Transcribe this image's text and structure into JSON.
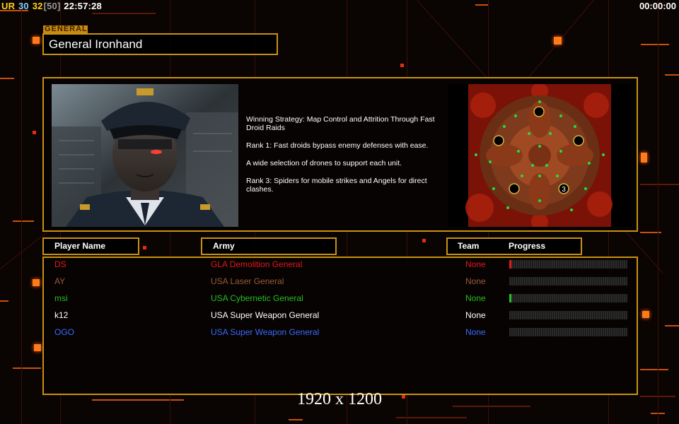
{
  "hud": {
    "stat1": "UR",
    "stat2": "30",
    "stat3": "32",
    "stat4": "[50]",
    "clock": "22:57:28",
    "timer": "00:00:00"
  },
  "general": {
    "tag": "GENERAL",
    "name": "General Ironhand"
  },
  "description": {
    "strategy": "Winning Strategy: Map Control and Attrition Through Fast Droid Raids",
    "rank1": "Rank 1: Fast droids bypass enemy defenses with ease.",
    "drones": "A wide selection of drones to support each unit.",
    "rank3": "Rank 3: Spiders for mobile strikes and Angels for direct clashes."
  },
  "minimap": {
    "start_label": "3"
  },
  "table": {
    "col_player": "Player Name",
    "col_army": "Army",
    "col_team": "Team",
    "col_progress": "Progress"
  },
  "players": [
    {
      "name": "DS",
      "army": "GLA Demolition General",
      "team": "None",
      "color": "#e01a1a",
      "progress": 0.01,
      "fill": "#e01a1a"
    },
    {
      "name": "AY",
      "army": "USA Laser General",
      "team": "None",
      "color": "#9a5a3a",
      "progress": 0.0,
      "fill": "#9a5a3a"
    },
    {
      "name": "msi",
      "army": "USA Cybernetic General",
      "team": "None",
      "color": "#22c022",
      "progress": 0.01,
      "fill": "#22c022"
    },
    {
      "name": "k12",
      "army": "USA Super Weapon General",
      "team": "None",
      "color": "#ffffff",
      "progress": 0.0,
      "fill": "#ffffff"
    },
    {
      "name": "OGO",
      "army": "USA Super Weapon General",
      "team": "None",
      "color": "#3a6aff",
      "progress": 0.0,
      "fill": "#3a6aff"
    }
  ],
  "resolution_text": "1920 x 1200",
  "colors": {
    "accent": "#c89210",
    "hud_ur": "#ffd21a",
    "hud_30": "#7fd0ff",
    "hud_32": "#ffd21a",
    "hud_50": "#9a9a9a"
  }
}
